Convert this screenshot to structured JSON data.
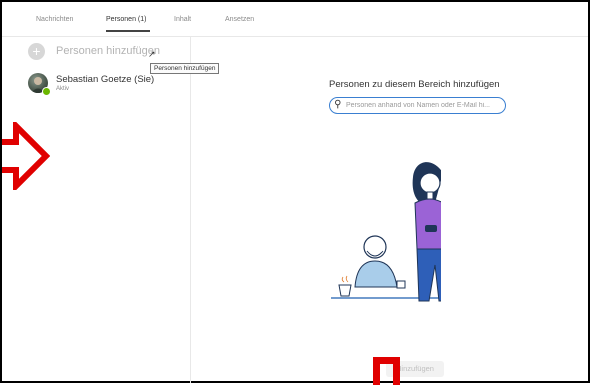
{
  "tabs": [
    {
      "label": "Nachrichten"
    },
    {
      "label": "Personen (1)"
    },
    {
      "label": "Inhalt"
    },
    {
      "label": "Ansetzen"
    }
  ],
  "left_pane": {
    "add_people_label": "Personen hinzufügen",
    "tooltip": "Personen hinzufügen",
    "members": [
      {
        "name": "Sebastian Goetze (Sie)",
        "status": "Aktiv"
      }
    ]
  },
  "right_pane": {
    "heading": "Personen zu diesem Bereich hinzufügen",
    "search_placeholder": "Personen anhand von Namen oder E-Mail hi...",
    "add_button_label": "Hinzufügen"
  },
  "colors": {
    "accent": "#3a7fd1",
    "annotation_red": "#e00000",
    "presence_green": "#6bb700"
  }
}
